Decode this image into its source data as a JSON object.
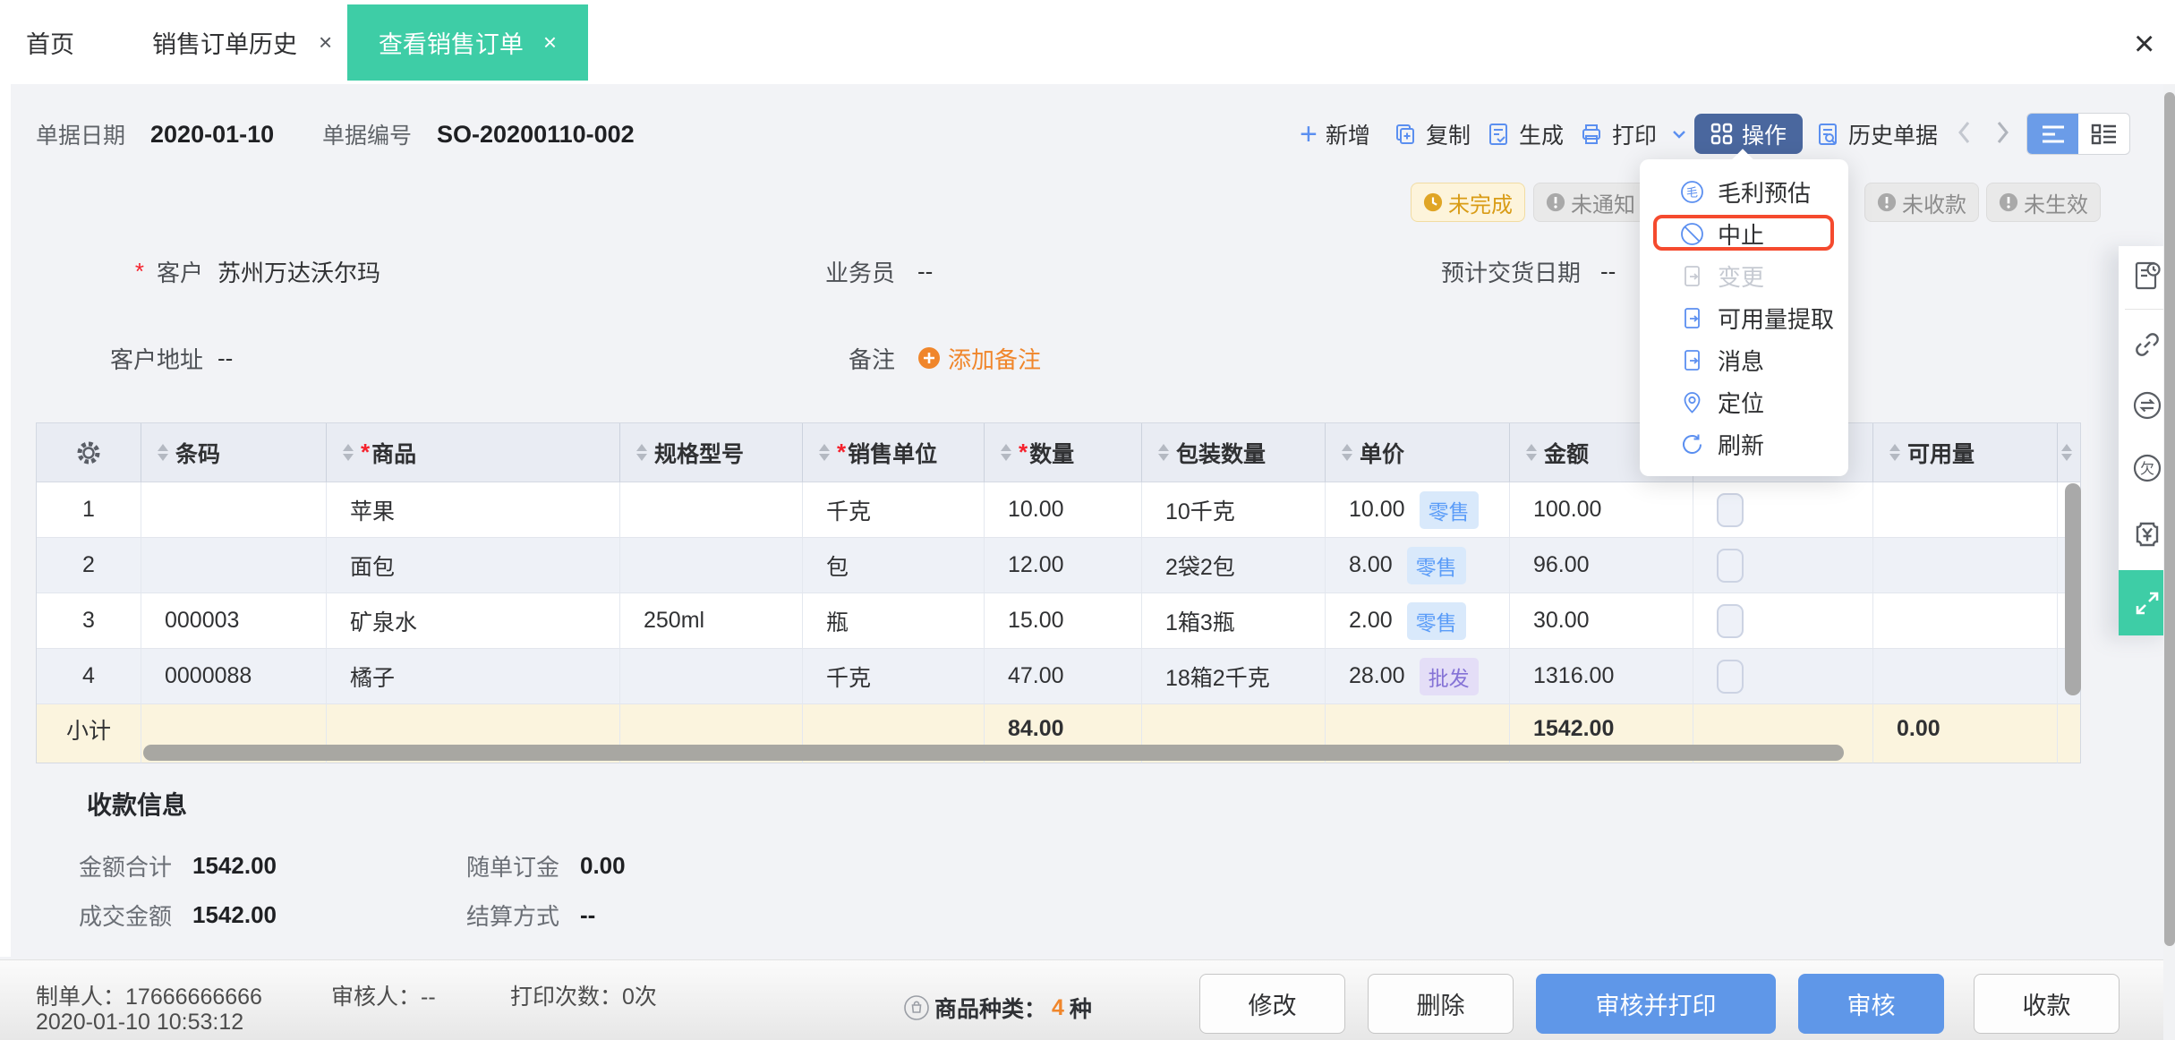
{
  "tabs": {
    "home": "首页",
    "history": "销售订单历史",
    "active": "查看销售订单",
    "close": "×"
  },
  "doc": {
    "date_label": "单据日期",
    "date_value": "2020-01-10",
    "no_label": "单据编号",
    "no_value": "SO-20200110-002"
  },
  "toolbar": {
    "add": "新增",
    "copy": "复制",
    "generate": "生成",
    "print": "打印",
    "action": "操作",
    "history_doc": "历史单据"
  },
  "badges": [
    {
      "label": "未完成"
    },
    {
      "label": "未通知"
    },
    {
      "label": "未收款"
    },
    {
      "label": "未生效"
    }
  ],
  "menu": {
    "items": [
      "毛利预估",
      "中止",
      "变更",
      "可用量提取",
      "消息",
      "定位",
      "刷新"
    ]
  },
  "form": {
    "customer_label": "客户",
    "customer_value": "苏州万达沃尔玛",
    "salesman_label": "业务员",
    "salesman_value": "--",
    "delivery_label": "预计交货日期",
    "delivery_value": "--",
    "address_label": "客户地址",
    "address_value": "--",
    "remark_label": "备注",
    "add_remark": "添加备注"
  },
  "table": {
    "headers": {
      "barcode": "条码",
      "product": "商品",
      "spec": "规格型号",
      "unit": "销售单位",
      "qty": "数量",
      "pack": "包装数量",
      "price": "单价",
      "amount": "金额",
      "available": "可用量"
    },
    "rows": [
      {
        "no": "1",
        "barcode": "",
        "product": "苹果",
        "spec": "",
        "unit": "千克",
        "qty": "10.00",
        "pack": "10千克",
        "price": "10.00",
        "price_tag": "零售",
        "amount": "100.00"
      },
      {
        "no": "2",
        "barcode": "",
        "product": "面包",
        "spec": "",
        "unit": "包",
        "qty": "12.00",
        "pack": "2袋2包",
        "price": "8.00",
        "price_tag": "零售",
        "amount": "96.00"
      },
      {
        "no": "3",
        "barcode": "000003",
        "product": "矿泉水",
        "spec": "250ml",
        "unit": "瓶",
        "qty": "15.00",
        "pack": "1箱3瓶",
        "price": "2.00",
        "price_tag": "零售",
        "amount": "30.00"
      },
      {
        "no": "4",
        "barcode": "0000088",
        "product": "橘子",
        "spec": "",
        "unit": "千克",
        "qty": "47.00",
        "pack": "18箱2千克",
        "price": "28.00",
        "price_tag": "批发",
        "amount": "1316.00"
      }
    ],
    "subtotal": {
      "label": "小计",
      "qty": "84.00",
      "amount": "1542.00",
      "available": "0.00"
    }
  },
  "payment": {
    "title": "收款信息",
    "total_label": "金额合计",
    "total_value": "1542.00",
    "deposit_label": "随单订金",
    "deposit_value": "0.00",
    "deal_label": "成交金额",
    "deal_value": "1542.00",
    "settle_label": "结算方式",
    "settle_value": "--"
  },
  "footer": {
    "maker_label": "制单人：",
    "maker_value": "17666666666",
    "maker_time": "2020-01-10 10:53:12",
    "auditor_label": "审核人：",
    "auditor_value": "--",
    "print_label": "打印次数：",
    "print_value": "0次",
    "category_label": "商品种类：",
    "category_value": "4",
    "category_unit": "种",
    "buttons": {
      "modify": "修改",
      "del": "删除",
      "audit_print": "审核并打印",
      "audit": "审核",
      "receive": "收款"
    }
  },
  "colors": {
    "accent_teal": "#3ecda6",
    "accent_blue": "#5b8ff0",
    "action_btn": "#4a679e",
    "highlight_red": "#f54a2e",
    "warn_text": "#d99c16",
    "orange": "#f0862b"
  }
}
